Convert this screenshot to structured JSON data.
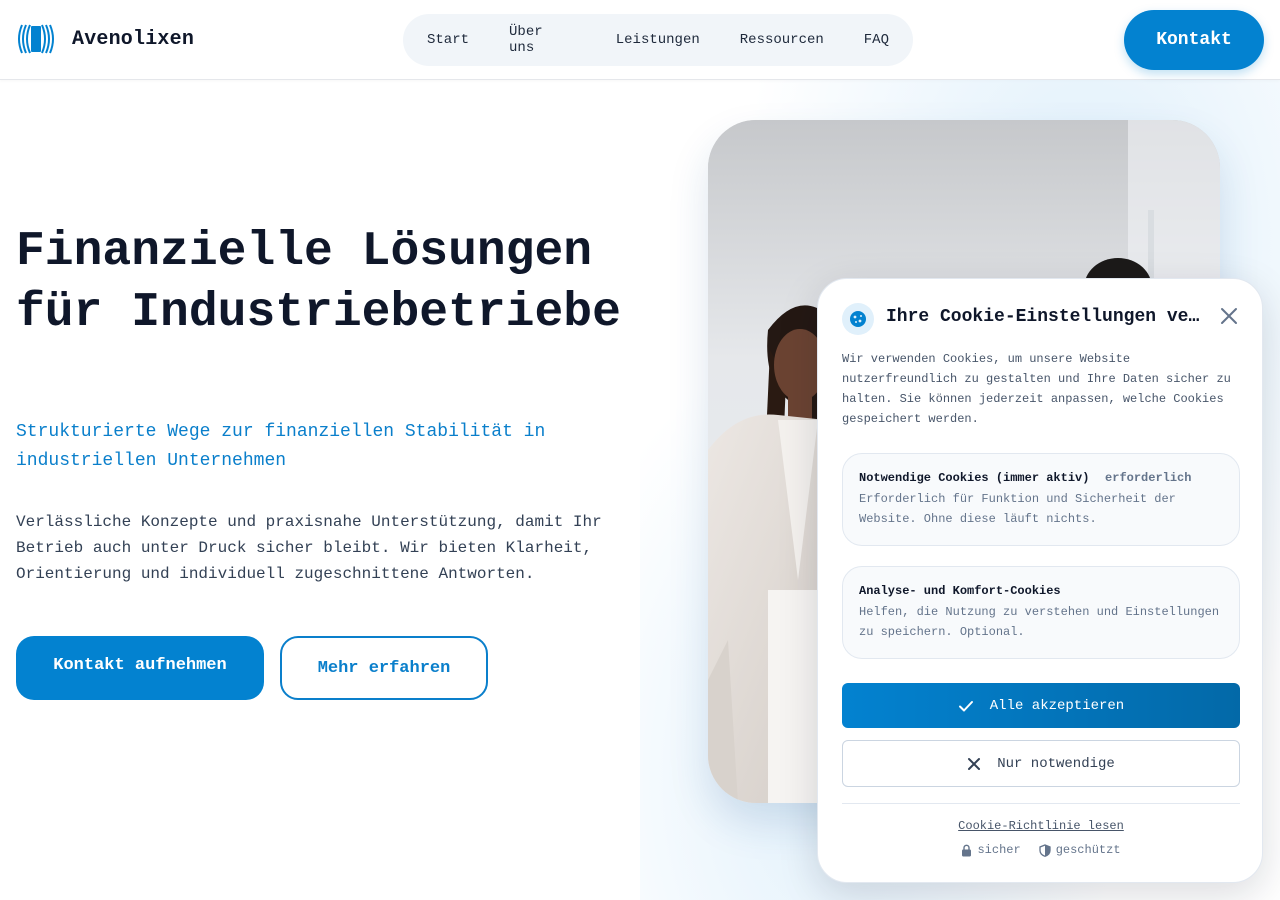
{
  "brand": {
    "name": "Avenolixen",
    "accent": "#0382d0"
  },
  "nav": {
    "items": [
      "Start",
      "Über uns",
      "Leistungen",
      "Ressourcen",
      "FAQ"
    ]
  },
  "header": {
    "cta_label": "Kontakt"
  },
  "hero": {
    "title": "Finanzielle Lösungen für Industriebetriebe",
    "subtitle": "Strukturierte Wege zur finanziellen Stabilität in industriellen Unternehmen",
    "text": "Verlässliche Konzepte und praxisnahe Unterstützung, damit Ihr Betrieb auch unter Druck sicher bleibt. Wir bieten Klarheit, Orientierung und individuell zugeschnittene Antworten.",
    "primary_label": "Kontakt aufnehmen",
    "secondary_label": "Mehr erfahren"
  },
  "cookie": {
    "icon": "cookie-icon",
    "title": "Ihre Cookie-Einstellungen verwalten",
    "description": "Wir verwenden Cookies, um unsere Website nutzerfreundlich zu gestalten und Ihre Daten sicher zu halten. Sie können jederzeit anpassen, welche Cookies gespeichert werden.",
    "options": [
      {
        "title": "Notwendige Cookies (immer aktiv)",
        "badge": "erforderlich",
        "text": "Erforderlich für Funktion und Sicherheit der Website. Ohne diese läuft nichts."
      },
      {
        "title": "Analyse- und Komfort-Cookies",
        "badge": "",
        "text": "Helfen, die Nutzung zu verstehen und Einstellungen zu speichern. Optional."
      }
    ],
    "accept_label": "Alle akzeptieren",
    "necessary_label": "Nur notwendige",
    "policy_link": "Cookie-Richtlinie lesen",
    "trust": [
      "sicher",
      "geschützt"
    ]
  }
}
